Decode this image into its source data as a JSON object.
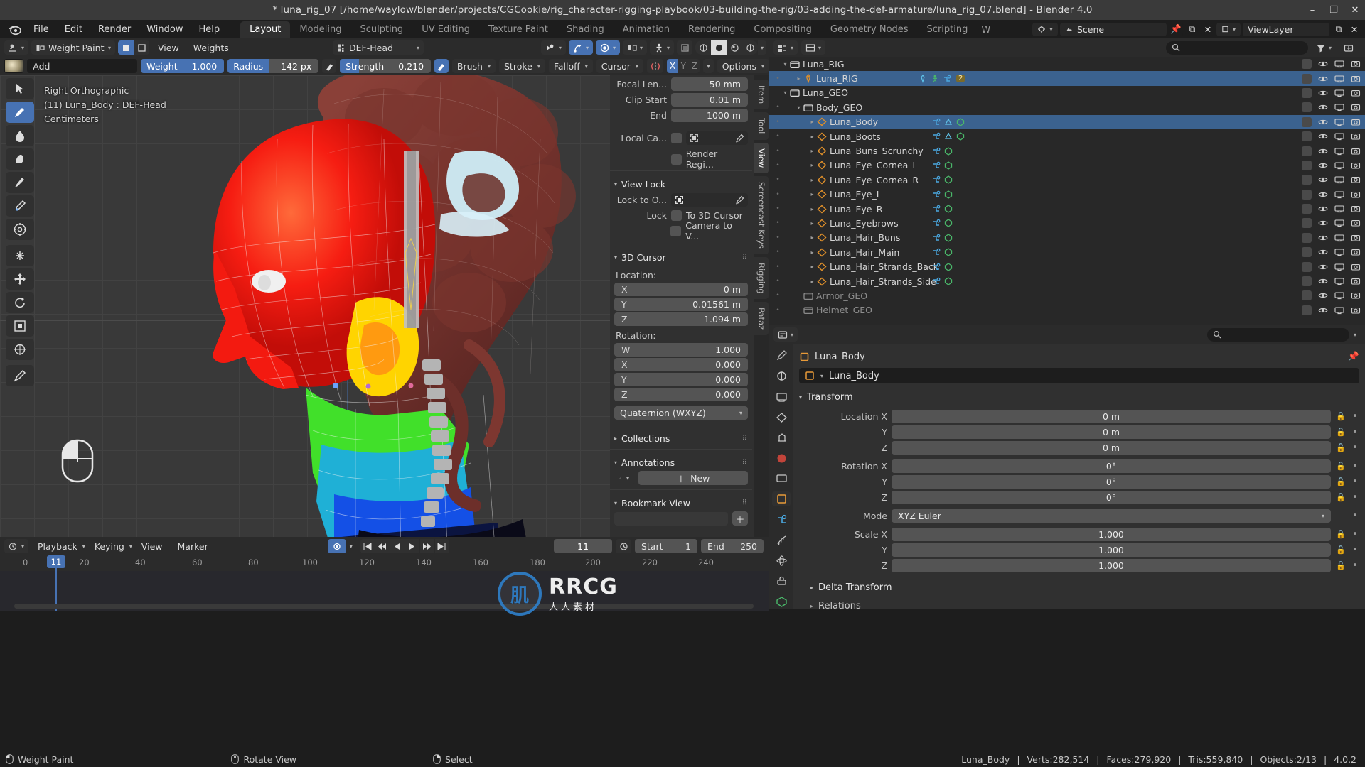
{
  "window": {
    "title": "* luna_rig_07 [/home/waylow/blender/projects/CGCookie/rig_character-rigging-playbook/03-building-the-rig/03-adding-the-def-armature/luna_rig_07.blend] - Blender 4.0",
    "minimize": "–",
    "maximize": "❐",
    "close": "✕"
  },
  "menubar": {
    "logo": "blender-logo",
    "items": [
      "File",
      "Edit",
      "Render",
      "Window",
      "Help"
    ],
    "workspaces": [
      {
        "label": "Layout",
        "active": true
      },
      {
        "label": "Modeling",
        "active": false
      },
      {
        "label": "Sculpting",
        "active": false
      },
      {
        "label": "UV Editing",
        "active": false
      },
      {
        "label": "Texture Paint",
        "active": false
      },
      {
        "label": "Shading",
        "active": false
      },
      {
        "label": "Animation",
        "active": false
      },
      {
        "label": "Rendering",
        "active": false
      },
      {
        "label": "Compositing",
        "active": false
      },
      {
        "label": "Geometry Nodes",
        "active": false
      },
      {
        "label": "Scripting",
        "active": false
      }
    ],
    "more": "W",
    "scene_name": "Scene",
    "viewlayer_name": "ViewLayer"
  },
  "viewport_header": {
    "editor_type": "editor-type-icon",
    "mode": "Weight Paint",
    "menus": [
      "View",
      "Weights"
    ],
    "active_bone": "DEF-Head",
    "overlay_dropdowns": [
      "visibility",
      "snapping",
      "proportional",
      "mirror",
      "pose-options"
    ]
  },
  "tool_settings": {
    "brush_name": "Add",
    "weight_label": "Weight",
    "weight_value": "1.000",
    "radius_label": "Radius",
    "radius_value": "142 px",
    "strength_label": "Strength",
    "strength_value": "0.210",
    "brush_menu": "Brush",
    "stroke_menu": "Stroke",
    "falloff_menu": "Falloff",
    "cursor_menu": "Cursor",
    "options_menu": "Options",
    "symmetry_axes": [
      {
        "label": "X",
        "on": true
      },
      {
        "label": "Y",
        "on": false
      },
      {
        "label": "Z",
        "on": false
      }
    ]
  },
  "viewport": {
    "view_name": "Right Orthographic",
    "object_line": "(11) Luna_Body : DEF-Head",
    "units": "Centimeters",
    "toolbar_icons": [
      "tweak-tool-icon",
      "draw-tool-icon",
      "blur-tool-icon",
      "average-tool-icon",
      "smear-tool-icon",
      "sample-weight-icon",
      "gradient-tool-icon",
      "cursor-tool-icon",
      "move-tool-icon",
      "rotate-tool-icon",
      "scale-tool-icon",
      "transform-tool-icon",
      "annotate-tool-icon"
    ],
    "mouse_hint": "mouse-icon"
  },
  "n_panel": {
    "tabs": [
      {
        "label": "Item",
        "active": false
      },
      {
        "label": "Tool",
        "active": false
      },
      {
        "label": "View",
        "active": true
      },
      {
        "label": "Screencast Keys",
        "active": false
      },
      {
        "label": "Rigging",
        "active": false
      },
      {
        "label": "Pataz",
        "active": false
      }
    ],
    "view_rows": [
      {
        "label": "Focal Len...",
        "value": "50 mm"
      },
      {
        "label": "Clip Start",
        "value": "0.01 m"
      },
      {
        "label": "End",
        "value": "1000 m"
      }
    ],
    "local_camera_label": "Local Ca...",
    "render_region_label": "Render Regi...",
    "view_lock_title": "View Lock",
    "lock_to_object_label": "Lock to O...",
    "lock_label": "Lock",
    "lock_to_3d_cursor": "To 3D Cursor",
    "camera_to_view": "Camera to V...",
    "cursor_title": "3D Cursor",
    "location_title": "Location:",
    "location": [
      {
        "axis": "X",
        "value": "0 m"
      },
      {
        "axis": "Y",
        "value": "0.01561 m"
      },
      {
        "axis": "Z",
        "value": "1.094 m"
      }
    ],
    "rotation_title": "Rotation:",
    "rotation": [
      {
        "axis": "W",
        "value": "1.000"
      },
      {
        "axis": "X",
        "value": "0.000"
      },
      {
        "axis": "Y",
        "value": "0.000"
      },
      {
        "axis": "Z",
        "value": "0.000"
      }
    ],
    "rotation_mode": "Quaternion (WXYZ)",
    "collections_title": "Collections",
    "annotations_title": "Annotations",
    "annotation_new": "New",
    "bookmark_title": "Bookmark View"
  },
  "timeline": {
    "editor_icon": "timeline-editor-icon",
    "menus": [
      "Playback",
      "Keying",
      "View",
      "Marker"
    ],
    "auto_key": "auto-keying-icon",
    "transport": [
      "jump-start",
      "prev-keyframe",
      "play-reverse",
      "play",
      "next-keyframe",
      "jump-end"
    ],
    "current_frame": "11",
    "start_label": "Start",
    "start_value": "1",
    "end_label": "End",
    "end_value": "250",
    "ruler_ticks": [
      "0",
      "20",
      "40",
      "60",
      "80",
      "100",
      "120",
      "140",
      "160",
      "180",
      "200",
      "220",
      "240"
    ],
    "playhead_label": "11"
  },
  "outliner": {
    "display_mode": "view-layer-icon",
    "filter_icon": "filter-icon",
    "search_placeholder": "",
    "rows": [
      {
        "indent": 0,
        "arrow": "▾",
        "icon": "scene-collection-icon",
        "name": "Luna_RIG",
        "sel": false,
        "type": "collection"
      },
      {
        "indent": 1,
        "arrow": "▸",
        "icon": "armature-icon",
        "name": "Luna_RIG",
        "sel": true,
        "type": "armature",
        "mods": [
          "armature-data",
          "pose-mode",
          "modifier"
        ],
        "badge": "2"
      },
      {
        "indent": 0,
        "arrow": "▾",
        "icon": "collection-icon",
        "name": "Luna_GEO",
        "sel": false,
        "type": "collection"
      },
      {
        "indent": 1,
        "arrow": "▾",
        "icon": "collection-icon",
        "name": "Body_GEO",
        "sel": false,
        "type": "collection"
      },
      {
        "indent": 2,
        "arrow": "▸",
        "icon": "mesh-icon",
        "name": "Luna_Body",
        "sel": true,
        "type": "mesh",
        "mods": [
          "modifier",
          "vertexgroup",
          "material"
        ]
      },
      {
        "indent": 2,
        "arrow": "▸",
        "icon": "mesh-icon",
        "name": "Luna_Boots",
        "sel": false,
        "type": "mesh",
        "mods": [
          "modifier",
          "vertexgroup",
          "material"
        ]
      },
      {
        "indent": 2,
        "arrow": "▸",
        "icon": "mesh-icon",
        "name": "Luna_Buns_Scrunchy",
        "sel": false,
        "type": "mesh",
        "mods": [
          "modifier",
          "material"
        ]
      },
      {
        "indent": 2,
        "arrow": "▸",
        "icon": "mesh-icon",
        "name": "Luna_Eye_Cornea_L",
        "sel": false,
        "type": "mesh",
        "mods": [
          "modifier",
          "material"
        ]
      },
      {
        "indent": 2,
        "arrow": "▸",
        "icon": "mesh-icon",
        "name": "Luna_Eye_Cornea_R",
        "sel": false,
        "type": "mesh",
        "mods": [
          "modifier",
          "material"
        ]
      },
      {
        "indent": 2,
        "arrow": "▸",
        "icon": "mesh-icon",
        "name": "Luna_Eye_L",
        "sel": false,
        "type": "mesh",
        "mods": [
          "modifier",
          "material"
        ]
      },
      {
        "indent": 2,
        "arrow": "▸",
        "icon": "mesh-icon",
        "name": "Luna_Eye_R",
        "sel": false,
        "type": "mesh",
        "mods": [
          "modifier",
          "material"
        ]
      },
      {
        "indent": 2,
        "arrow": "▸",
        "icon": "mesh-icon",
        "name": "Luna_Eyebrows",
        "sel": false,
        "type": "mesh",
        "mods": [
          "modifier",
          "material"
        ]
      },
      {
        "indent": 2,
        "arrow": "▸",
        "icon": "mesh-icon",
        "name": "Luna_Hair_Buns",
        "sel": false,
        "type": "mesh",
        "mods": [
          "modifier",
          "material"
        ]
      },
      {
        "indent": 2,
        "arrow": "▸",
        "icon": "mesh-icon",
        "name": "Luna_Hair_Main",
        "sel": false,
        "type": "mesh",
        "mods": [
          "modifier",
          "material"
        ]
      },
      {
        "indent": 2,
        "arrow": "▸",
        "icon": "mesh-icon",
        "name": "Luna_Hair_Strands_Back",
        "sel": false,
        "type": "mesh",
        "mods": [
          "modifier",
          "material"
        ]
      },
      {
        "indent": 2,
        "arrow": "▸",
        "icon": "mesh-icon",
        "name": "Luna_Hair_Strands_Side",
        "sel": false,
        "type": "mesh",
        "mods": [
          "modifier",
          "material"
        ]
      },
      {
        "indent": 1,
        "arrow": "",
        "icon": "collection-excluded-icon",
        "name": "Armor_GEO",
        "sel": false,
        "type": "collection-off"
      },
      {
        "indent": 1,
        "arrow": "",
        "icon": "collection-excluded-icon",
        "name": "Helmet_GEO",
        "sel": false,
        "type": "collection-off"
      }
    ]
  },
  "properties": {
    "editor_icon": "properties-editor-icon",
    "search_placeholder": "",
    "breadcrumb_object": "Luna_Body",
    "pin_icon": "pin-icon",
    "object_name": "Luna_Body",
    "tabs": [
      "tool-tab",
      "render-tab",
      "output-tab",
      "view-layer-tab",
      "scene-tab",
      "world-tab",
      "collection-tab",
      "object-tab",
      "modifier-tab",
      "particles-tab",
      "physics-tab",
      "constraints-tab",
      "data-tab"
    ],
    "transform_title": "Transform",
    "location_rows": [
      {
        "label": "Location X",
        "value": "0 m"
      },
      {
        "label": "Y",
        "value": "0 m"
      },
      {
        "label": "Z",
        "value": "0 m"
      }
    ],
    "rotation_rows": [
      {
        "label": "Rotation X",
        "value": "0°"
      },
      {
        "label": "Y",
        "value": "0°"
      },
      {
        "label": "Z",
        "value": "0°"
      }
    ],
    "mode_label": "Mode",
    "mode_value": "XYZ Euler",
    "scale_rows": [
      {
        "label": "Scale X",
        "value": "1.000"
      },
      {
        "label": "Y",
        "value": "1.000"
      },
      {
        "label": "Z",
        "value": "1.000"
      }
    ],
    "delta_transform_title": "Delta Transform",
    "relations_title": "Relations"
  },
  "statusbar": {
    "items": [
      {
        "icon": "mouse-left-icon",
        "label": "Weight Paint"
      },
      {
        "icon": "mouse-middle-icon",
        "label": "Rotate View"
      },
      {
        "icon": "mouse-right-icon",
        "label": "Select"
      }
    ],
    "stats": [
      "Luna_Body",
      "Verts:282,514",
      "Faces:279,920",
      "Tris:559,840",
      "Objects:2/13",
      "4.0.2"
    ]
  },
  "watermark": {
    "logo": "RRCG-logo",
    "line1": "RRCG",
    "line2": "人人素材"
  },
  "colors": {
    "accent_blue": "#4772b3",
    "header_bg": "#2b2b2b",
    "panel_bg": "#303030",
    "outliner_bg": "#282828",
    "selected_row": "#3b628f"
  }
}
